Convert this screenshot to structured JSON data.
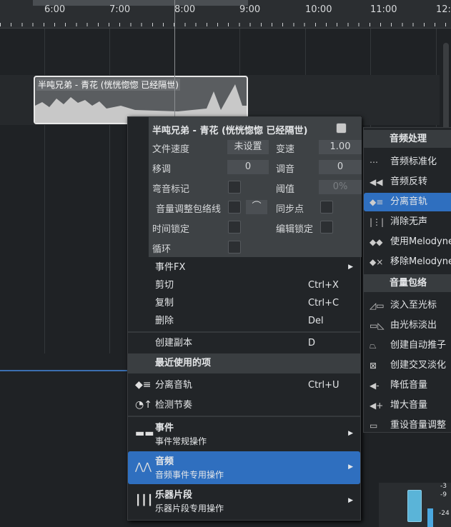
{
  "timeline": {
    "ticks": [
      "6:00",
      "7:00",
      "8:00",
      "9:00",
      "10:00",
      "11:00",
      "12:0"
    ]
  },
  "event": {
    "title": "半吨兄弟 - 青花 (恍恍惚惚 已经隔世)"
  },
  "inspector": {
    "title": "半吨兄弟 - 青花 (恍恍惚惚 已经隔世)",
    "file_tempo_label": "文件速度",
    "file_tempo_value": "未设置",
    "speed_label": "变速",
    "speed_value": "1.00",
    "transpose_label": "移调",
    "transpose_value": "0",
    "tune_label": "调音",
    "tune_value": "0",
    "bend_label": "弯音标记",
    "threshold_label": "阈值",
    "threshold_value": "0%",
    "envelope_label": "音量调整包络线",
    "sync_label": "同步点",
    "timelock_label": "时间锁定",
    "editlock_label": "编辑锁定",
    "loop_label": "循环"
  },
  "menu": {
    "items": [
      {
        "label": "事件FX",
        "submenu": true
      },
      {
        "label": "剪切",
        "shortcut": "Ctrl+X"
      },
      {
        "label": "复制",
        "shortcut": "Ctrl+C"
      },
      {
        "label": "删除",
        "shortcut": "Del"
      }
    ],
    "duplicate": {
      "label": "创建副本",
      "shortcut": "D"
    },
    "recent_header": "最近使用的项",
    "recent": [
      {
        "label": "分离音轨",
        "shortcut": "Ctrl+U",
        "icon": "split-audio-icon"
      },
      {
        "label": "检测节奏",
        "icon": "detect-tempo-icon"
      }
    ],
    "groups": [
      {
        "title": "事件",
        "subtitle": "事件常规操作",
        "icon": "event-icon"
      },
      {
        "title": "音频",
        "subtitle": "音频事件专用操作",
        "icon": "audio-wave-icon",
        "highlighted": true
      },
      {
        "title": "乐器片段",
        "subtitle": "乐器片段专用操作",
        "icon": "instrument-icon"
      }
    ]
  },
  "submenu": {
    "header1": "音频处理",
    "items1": [
      "音频标准化",
      "音频反转",
      "分离音轨",
      "消除无声",
      "使用Melodyne",
      "移除Melodyne"
    ],
    "icons1": [
      "normalize-icon",
      "reverse-icon",
      "split-audio-icon",
      "strip-silence-icon",
      "melodyne-icon",
      "remove-melodyne-icon"
    ],
    "highlighted": "分离音轨",
    "header2": "音量包络",
    "items2": [
      "淡入至光标",
      "由光标淡出",
      "创建自动推子",
      "创建交叉淡化",
      "降低音量",
      "增大音量",
      "重设音量调整"
    ],
    "icons2": [
      "fade-in-icon",
      "fade-out-icon",
      "auto-fader-icon",
      "crossfade-icon",
      "volume-down-icon",
      "volume-up-icon",
      "reset-envelope-icon"
    ]
  },
  "meter": {
    "labels": [
      "-3",
      "-9",
      "-24"
    ]
  },
  "colors": {
    "accent": "#2f6fbf",
    "background": "#1f2225"
  }
}
